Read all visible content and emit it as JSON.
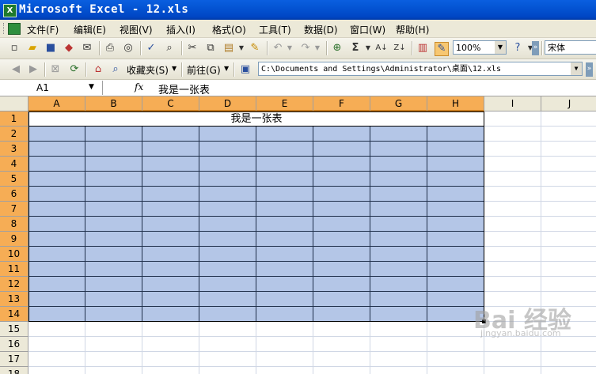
{
  "window": {
    "title": "Microsoft Excel - 12.xls"
  },
  "menu": [
    "文件(F)",
    "编辑(E)",
    "视图(V)",
    "插入(I)",
    "格式(O)",
    "工具(T)",
    "数据(D)",
    "窗口(W)",
    "帮助(H)"
  ],
  "toolbar1": {
    "zoom": "100%",
    "font": "宋体"
  },
  "toolbar2": {
    "favorites": "收藏夹(S)",
    "goto": "前往(G)",
    "address": "C:\\Documents and Settings\\Administrator\\桌面\\12.xls"
  },
  "formula_bar": {
    "cell_ref": "A1",
    "fx": "fx",
    "content": "我是一张表"
  },
  "sheet": {
    "columns": [
      "A",
      "B",
      "C",
      "D",
      "E",
      "F",
      "G",
      "H",
      "I",
      "J"
    ],
    "rows": [
      "1",
      "2",
      "3",
      "4",
      "5",
      "6",
      "7",
      "8",
      "9",
      "10",
      "11",
      "12",
      "13",
      "14",
      "15",
      "16",
      "17",
      "18"
    ],
    "merged_cell_text": "我是一张表",
    "selected_range": "A1:H14",
    "fill_color": "#b4c6e7",
    "header_highlight": "#f6ad55"
  },
  "watermark": {
    "text": "Bai 经验",
    "url": "jingyan.baidu.com"
  }
}
